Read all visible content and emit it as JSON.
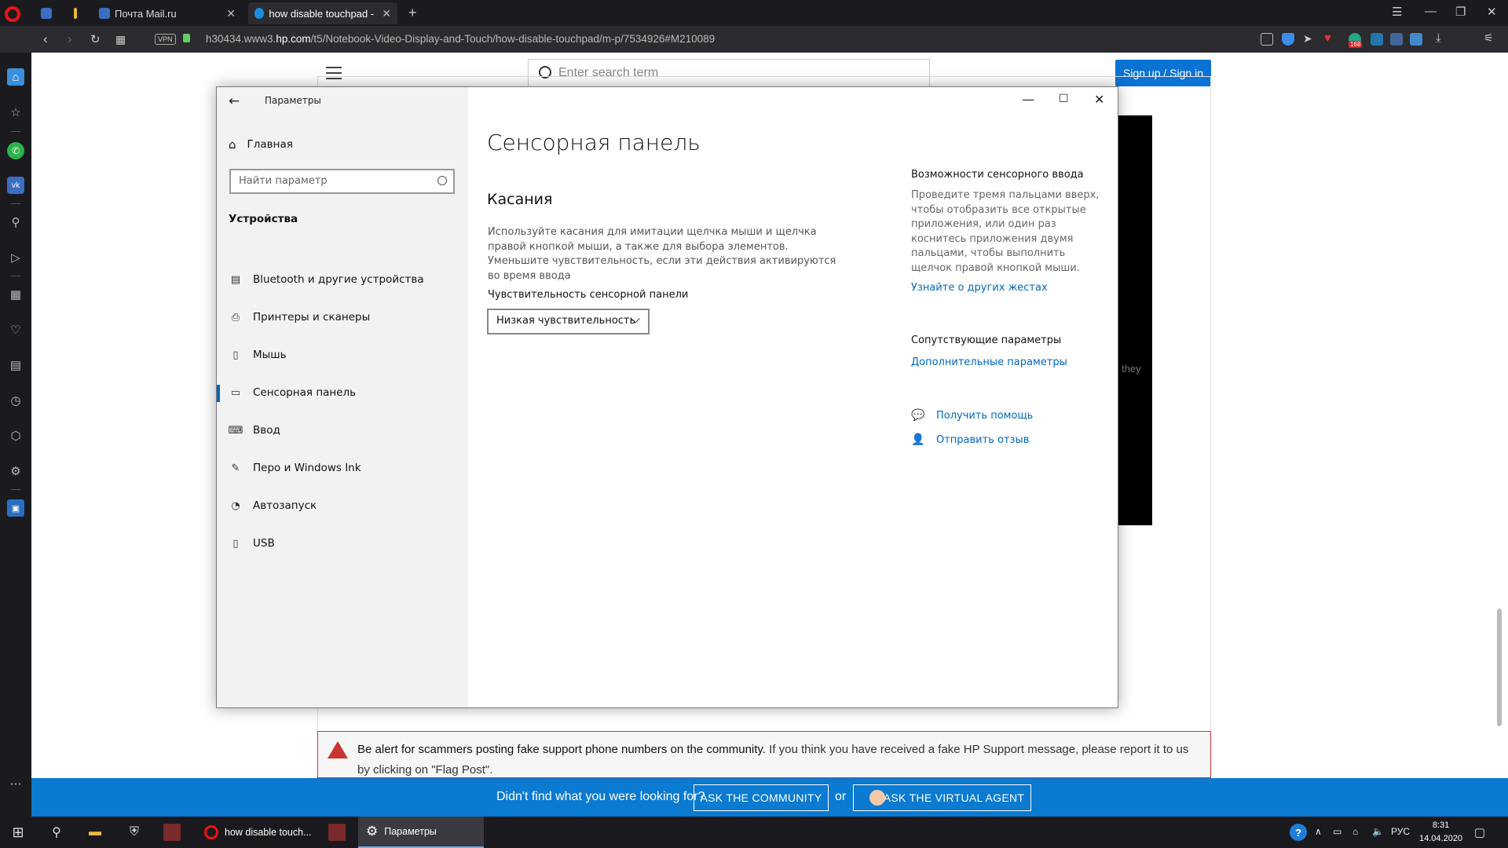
{
  "browser": {
    "tabs": [
      {
        "label": ""
      },
      {
        "label": ""
      },
      {
        "label": "Почта Mail.ru"
      },
      {
        "label": "how disable touchpad - HP"
      }
    ],
    "url_prefix": "h30434.www3.",
    "url_domain": "hp.com",
    "url_path": "/t5/Notebook-Video-Display-and-Touch/how-disable-touchpad/m-p/7534926#M210089",
    "vpn_label": "VPN",
    "badge_count": "168"
  },
  "webpage": {
    "search_placeholder": "Enter search term",
    "signup_label": "Sign up / Sign in",
    "partial_text": "they",
    "alert_bold": "Be alert for scammers posting fake support phone numbers on the community.",
    "alert_text": " If you think you have received a fake HP Support message, please report it to us by clicking on \"Flag Post\".",
    "bluebar_question": "Didn't find what you were looking for?",
    "ask_community": "ASK THE COMMUNITY",
    "or_label": "or",
    "ask_agent": "ASK THE VIRTUAL AGENT"
  },
  "settings": {
    "app_title": "Параметры",
    "home_label": "Главная",
    "search_placeholder": "Найти параметр",
    "group_label": "Устройства",
    "nav_items": [
      {
        "label": "Bluetooth и другие устройства",
        "icon": "bluetooth-devices-icon"
      },
      {
        "label": "Принтеры и сканеры",
        "icon": "printer-icon"
      },
      {
        "label": "Мышь",
        "icon": "mouse-icon"
      },
      {
        "label": "Сенсорная панель",
        "icon": "touchpad-icon"
      },
      {
        "label": "Ввод",
        "icon": "keyboard-icon"
      },
      {
        "label": "Перо и Windows Ink",
        "icon": "pen-icon"
      },
      {
        "label": "Автозапуск",
        "icon": "autoplay-icon"
      },
      {
        "label": "USB",
        "icon": "usb-icon"
      }
    ],
    "page_title": "Сенсорная панель",
    "section_title": "Касания",
    "section_desc": "Используйте касания для имитации щелчка мыши и щелчка правой кнопкой мыши, а также для выбора элементов. Уменьшите чувствительность, если эти действия активируются во время ввода",
    "sensitivity_label": "Чувствительность сенсорной панели",
    "sensitivity_value": "Низкая чувствительность",
    "right_heading": "Возможности сенсорного ввода",
    "right_desc": "Проведите тремя пальцами вверх, чтобы отобразить все открытые приложения, или один раз коснитесь приложения двумя пальцами, чтобы выполнить щелчок правой кнопкой мыши.",
    "right_link": "Узнайте о других жестах",
    "related_heading": "Сопутствующие параметры",
    "related_link": "Дополнительные параметры",
    "help_label": "Получить помощь",
    "feedback_label": "Отправить отзыв"
  },
  "taskbar": {
    "opera_app": "how disable touch...",
    "settings_app": "Параметры",
    "language": "РУС",
    "time": "8:31",
    "date": "14.04.2020"
  },
  "colors": {
    "accent": "#0067c0",
    "hp_blue": "#0b7ad1",
    "alert_red": "#cc3333"
  }
}
